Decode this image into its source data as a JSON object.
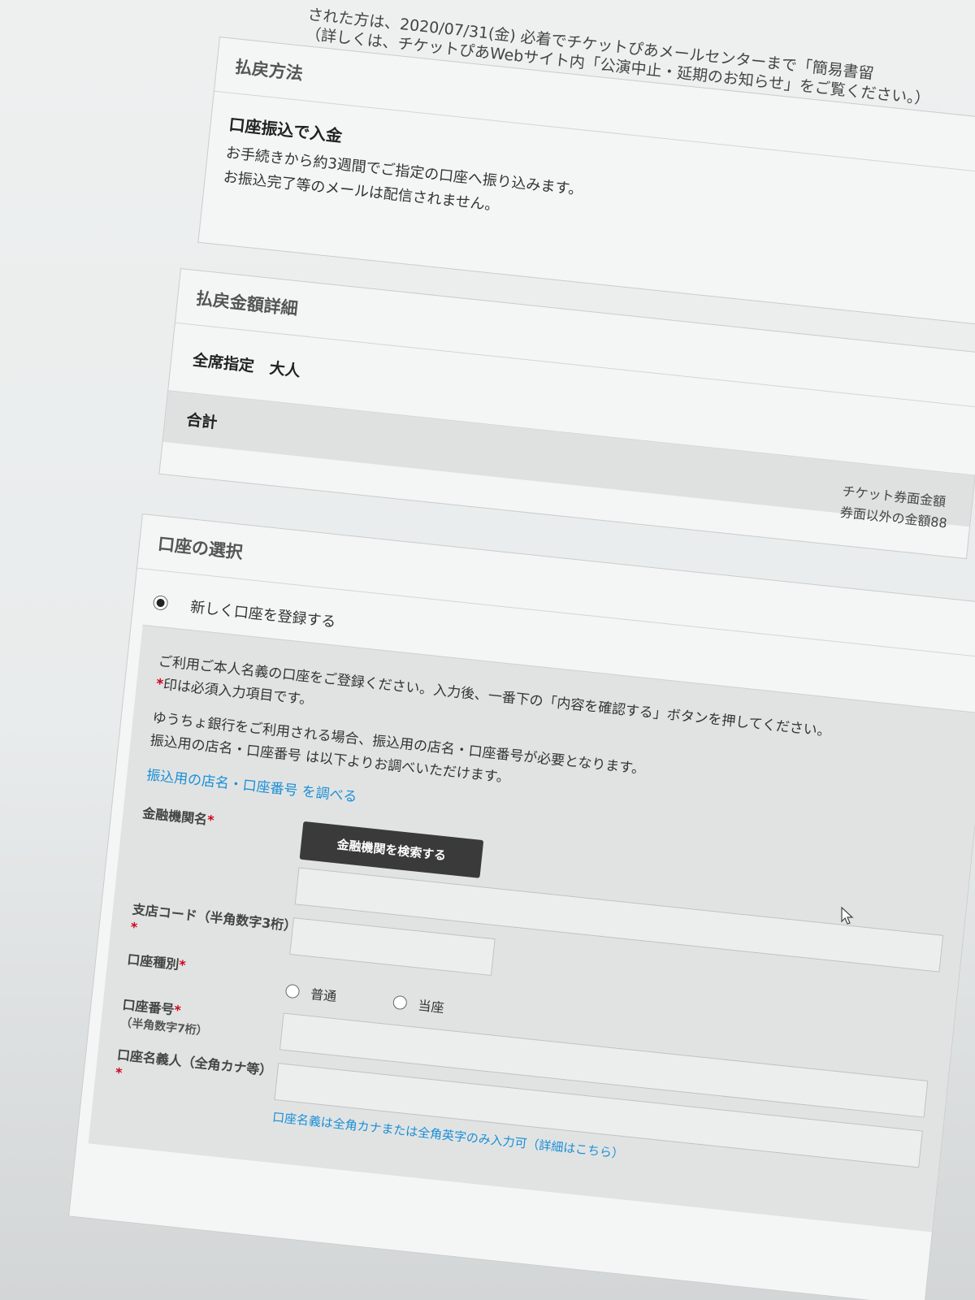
{
  "notice": {
    "line1": "された方は、2020/07/31(金) 必着でチケットぴあメールセンターまで「簡易書留",
    "line2": "（詳しくは、チケットぴあWebサイト内「公演中止・延期のお知らせ」をご覧ください。）"
  },
  "refund_method": {
    "title": "払戻方法",
    "subtitle": "口座振込で入金",
    "line1": "お手続きから約3週間でご指定の口座へ振り込みます。",
    "line2": "お振込完了等のメールは配信されません。"
  },
  "refund_detail": {
    "title": "払戻金額詳細",
    "row_label": "全席指定　大人",
    "total_label": "合計"
  },
  "side_note": {
    "line1": "チケット券面金額",
    "line2": "券面以外の金額88"
  },
  "account": {
    "title": "口座の選択",
    "new_option": "新しく口座を登録する",
    "instr1": "ご利用ご本人名義の口座をご登録ください。入力後、一番下の「内容を確認する」ボタンを押してください。",
    "asterisk": "*",
    "instr2": "印は必須入力項目です。",
    "yucho1": "ゆうちょ銀行をご利用される場合、振込用の店名・口座番号が必要となります。",
    "yucho2": "振込用の店名・口座番号 は以下よりお調べいただけます。",
    "yucho_link": "振込用の店名・口座番号 を調べる",
    "bank_label": "金融機関名",
    "bank_button": "金融機関を検索する",
    "branch_label": "支店コード（半角数字3桁）",
    "type_label": "口座種別",
    "type_options": [
      "普通",
      "当座"
    ],
    "number_label": "口座番号",
    "number_sub": "（半角数字7桁）",
    "holder_label": "口座名義人（全角カナ等）",
    "holder_hint": "口座名義は全角カナまたは全角英字のみ入力可（詳細はこちら）"
  }
}
